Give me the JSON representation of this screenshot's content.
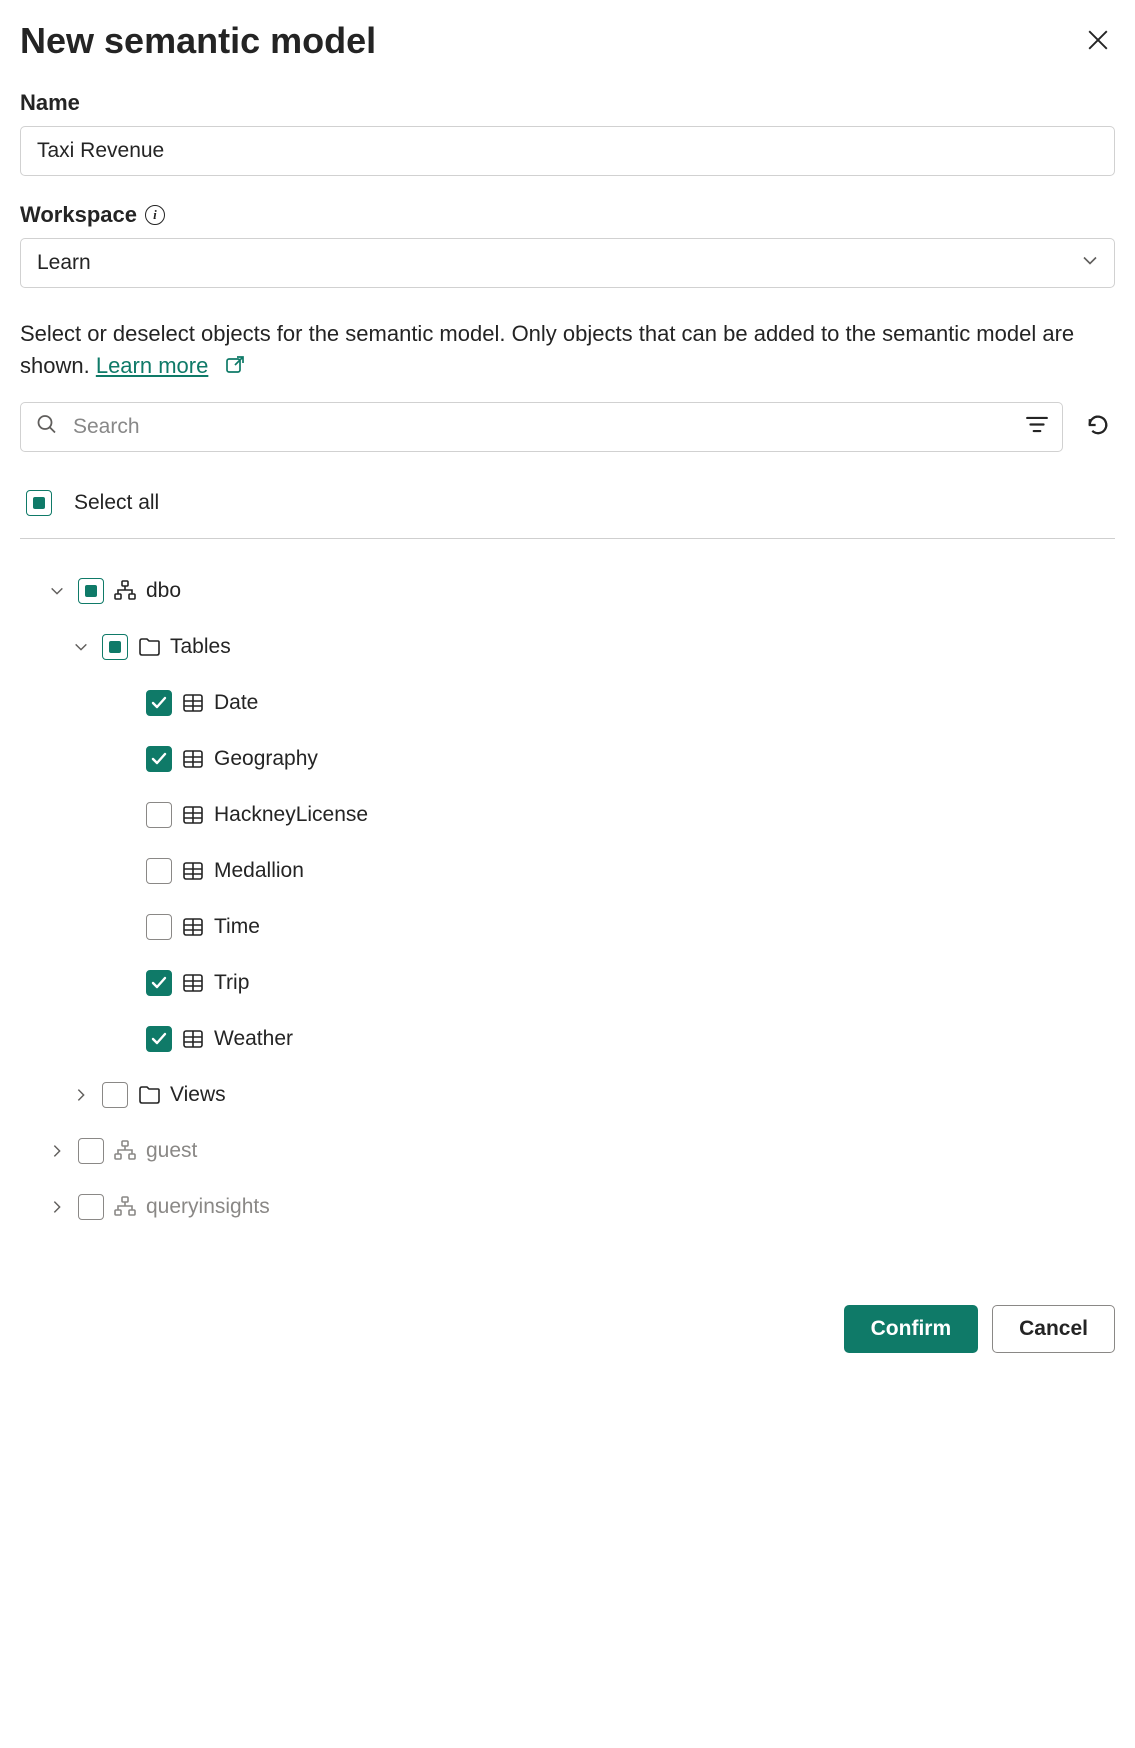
{
  "dialog": {
    "title": "New semantic model"
  },
  "name": {
    "label": "Name",
    "value": "Taxi Revenue"
  },
  "workspace": {
    "label": "Workspace",
    "value": "Learn"
  },
  "help": {
    "text_part1": "Select or deselect objects for the semantic model. Only objects that can be added to the semantic model are shown. ",
    "learn_more": "Learn more"
  },
  "search": {
    "placeholder": "Search"
  },
  "select_all": {
    "label": "Select all",
    "state": "indeterminate"
  },
  "tree": {
    "schemas": [
      {
        "name": "dbo",
        "state": "indeterminate",
        "expanded": true,
        "muted": false,
        "children": [
          {
            "name": "Tables",
            "kind": "folder",
            "state": "indeterminate",
            "expanded": true,
            "tables": [
              {
                "name": "Date",
                "checked": true
              },
              {
                "name": "Geography",
                "checked": true
              },
              {
                "name": "HackneyLicense",
                "checked": false
              },
              {
                "name": "Medallion",
                "checked": false
              },
              {
                "name": "Time",
                "checked": false
              },
              {
                "name": "Trip",
                "checked": true
              },
              {
                "name": "Weather",
                "checked": true
              }
            ]
          },
          {
            "name": "Views",
            "kind": "folder",
            "state": "unchecked",
            "expanded": false
          }
        ]
      },
      {
        "name": "guest",
        "state": "unchecked",
        "expanded": false,
        "muted": true
      },
      {
        "name": "queryinsights",
        "state": "unchecked",
        "expanded": false,
        "muted": true
      }
    ]
  },
  "footer": {
    "confirm": "Confirm",
    "cancel": "Cancel"
  },
  "colors": {
    "accent": "#0f7a68"
  }
}
